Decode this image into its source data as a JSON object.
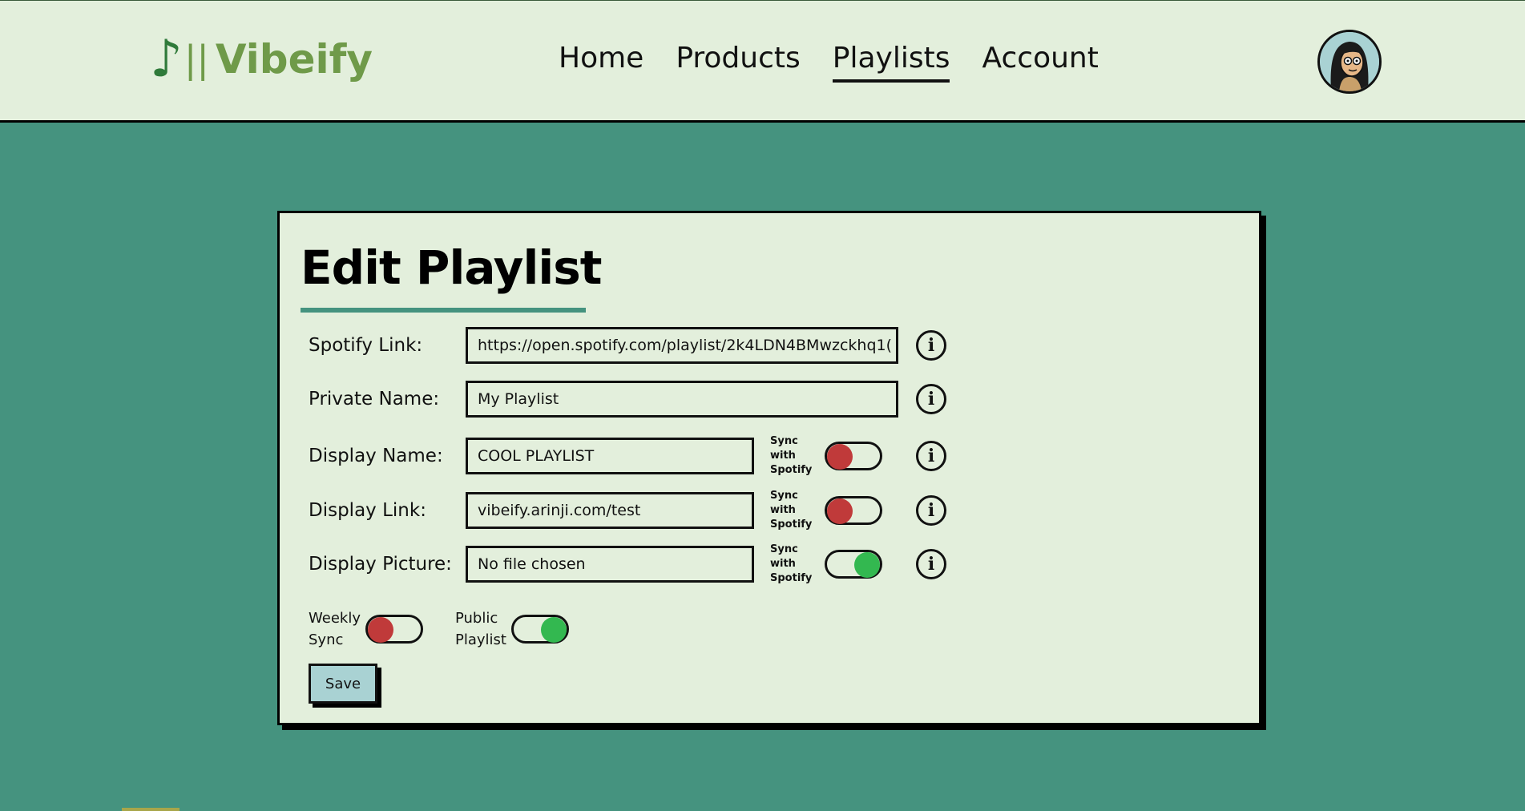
{
  "header": {
    "logo_note": "♪",
    "logo_bars": "||",
    "logo_text": "Vibeify",
    "nav": [
      {
        "label": "Home"
      },
      {
        "label": "Products"
      },
      {
        "label": "Playlists"
      },
      {
        "label": "Account"
      }
    ],
    "active_nav": "Playlists"
  },
  "form": {
    "title": "Edit Playlist",
    "spotify_link": {
      "label": "Spotify Link:",
      "value": "https://open.spotify.com/playlist/2k4LDN4BMwzckhq1("
    },
    "private_name": {
      "label": "Private Name:",
      "value": "My Playlist"
    },
    "display_name": {
      "label": "Display Name:",
      "value": "COOL PLAYLIST",
      "sync_label": "Sync with Spotify",
      "sync_on": false
    },
    "display_link": {
      "label": "Display Link:",
      "value": "vibeify.arinji.com/test",
      "sync_label": "Sync with Spotify",
      "sync_on": false
    },
    "display_picture": {
      "label": "Display Picture:",
      "value": "No file chosen",
      "sync_label": "Sync with Spotify",
      "sync_on": true
    },
    "weekly_sync": {
      "label_line1": "Weekly",
      "label_line2": "Sync",
      "on": false
    },
    "public_playlist": {
      "label_line1": "Public",
      "label_line2": "Playlist",
      "on": true
    },
    "save_label": "Save",
    "info_glyph": "i"
  },
  "colors": {
    "background": "#45937f",
    "panel": "#e3efdc",
    "logo_green": "#6f9a49",
    "toggle_off": "#c03a3a",
    "toggle_on": "#33b850",
    "save_button": "#a9d2d3"
  }
}
